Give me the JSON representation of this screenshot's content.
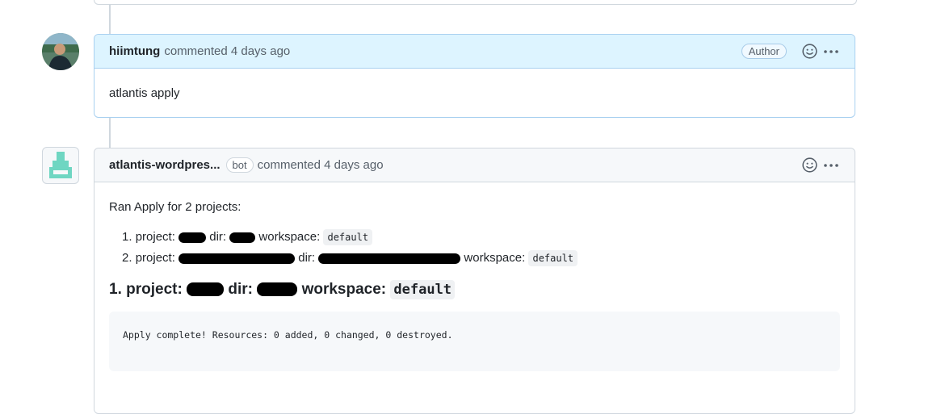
{
  "comment1": {
    "author": "hiimtung",
    "meta": "commented 4 days ago",
    "author_badge": "Author",
    "body": "atlantis apply"
  },
  "comment2": {
    "author": "atlantis-wordpres...",
    "bot_badge": "bot",
    "meta": "commented 4 days ago",
    "intro": "Ran Apply for 2 projects:",
    "list": [
      {
        "num": "1.",
        "project_label": "project:",
        "dir_label": "dir:",
        "workspace_label": "workspace:",
        "workspace": "default"
      },
      {
        "num": "2.",
        "project_label": "project:",
        "dir_label": "dir:",
        "workspace_label": "workspace:",
        "workspace": "default"
      }
    ],
    "heading": {
      "num": "1.",
      "project_label": "project:",
      "dir_label": "dir:",
      "workspace_label": "workspace:",
      "workspace": "default"
    },
    "output": "Apply complete! Resources: 0 added, 0 changed, 0 destroyed."
  },
  "icons": {
    "reaction": "smiley-icon",
    "more": "kebab-horizontal-icon"
  },
  "colors": {
    "author_header_bg": "#ddf4ff",
    "bot_avatar": "#6fd6c2"
  }
}
